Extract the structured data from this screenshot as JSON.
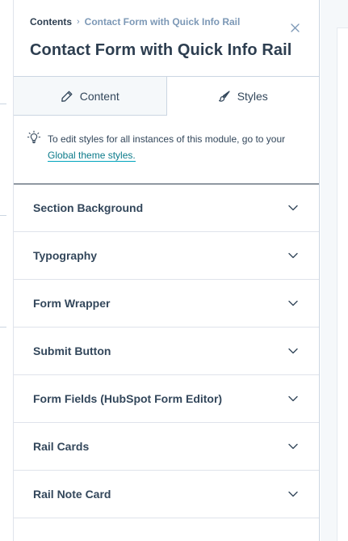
{
  "header": {
    "breadcrumb_root": "Contents",
    "breadcrumb_sep": "›",
    "breadcrumb_current": "Contact Form with Quick Info Rail",
    "title": "Contact Form with Quick Info Rail",
    "close_icon": "close-icon"
  },
  "tabs": [
    {
      "label": "Content",
      "icon": "pencil-icon",
      "active": false
    },
    {
      "label": "Styles",
      "icon": "brush-icon",
      "active": true
    }
  ],
  "info": {
    "icon": "lightbulb-icon",
    "text": "To edit styles for all instances of this module, go to your",
    "link": "Global theme styles."
  },
  "sections": [
    {
      "label": "Section Background"
    },
    {
      "label": "Typography"
    },
    {
      "label": "Form Wrapper"
    },
    {
      "label": "Submit Button"
    },
    {
      "label": "Form Fields (HubSpot Form Editor)"
    },
    {
      "label": "Rail Cards"
    },
    {
      "label": "Rail Note Card"
    }
  ],
  "colors": {
    "text": "#33475b",
    "heading": "#2d3e50",
    "muted": "#7c98b6",
    "border": "#cbd6e2",
    "link": "#0b7a8a",
    "tab_inactive_bg": "#f5f8fa"
  }
}
